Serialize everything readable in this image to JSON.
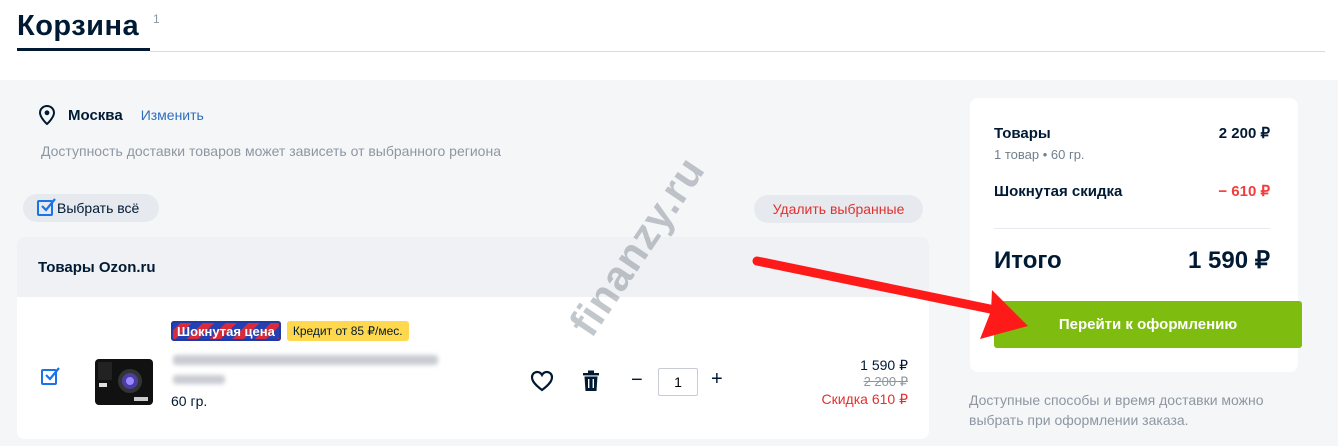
{
  "header": {
    "title": "Корзина",
    "count": "1"
  },
  "location": {
    "city": "Москва",
    "change_label": "Изменить",
    "note": "Доступность доставки товаров может зависеть от выбранного региона"
  },
  "actions": {
    "select_all": "Выбрать всё",
    "delete_selected": "Удалить выбранные"
  },
  "seller": {
    "title": "Товары Ozon.ru"
  },
  "item": {
    "badge_shock": "Шокнутая цена",
    "badge_credit": "Кредит от 85 ₽/мес.",
    "weight": "60 гр.",
    "quantity": "1",
    "price": "1 590 ₽",
    "old_price": "2 200 ₽",
    "discount": "Скидка 610 ₽",
    "selected": true
  },
  "summary": {
    "goods_label": "Товары",
    "goods_value": "2 200 ₽",
    "goods_sub": "1 товар • 60 гр.",
    "discount_label": "Шокнутая скидка",
    "discount_value": "− 610 ₽",
    "total_label": "Итого",
    "total_value": "1 590 ₽",
    "checkout_label": "Перейти к оформлению",
    "note": "Доступные способы и время доставки можно выбрать при оформлении заказа."
  },
  "overlay": {
    "watermark": "finanzy.ru"
  },
  "colors": {
    "accent": "#7fbc10",
    "link": "#2f6ebd",
    "danger": "#f23c3c",
    "checkbox": "#1a73e8",
    "arrow": "#ff1a1a"
  },
  "icons": {
    "location": "map-pin-icon",
    "heart": "heart-icon",
    "trash": "trash-icon",
    "checkbox": "checkmark-icon"
  }
}
